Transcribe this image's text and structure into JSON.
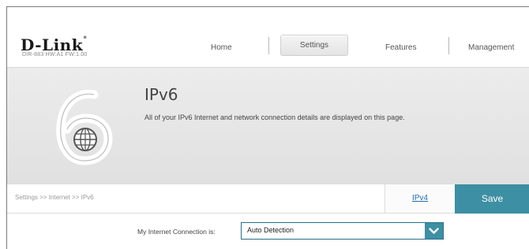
{
  "header": {
    "logo_text": "D-Link",
    "model_info": "DIR-883   HW:A1   FW:1.00",
    "nav": {
      "home": "Home",
      "settings": "Settings",
      "features": "Features",
      "management": "Management"
    }
  },
  "banner": {
    "title": "IPv6",
    "description": "All of your IPv6 Internet and network connection details are displayed on this page.",
    "icon": "ipv6-globe-icon"
  },
  "breadcrumb": {
    "text": "Settings >> Internet >> IPv6",
    "ipv4_link": "IPv4",
    "save_label": "Save"
  },
  "form": {
    "connection_label": "My Internet Connection is:",
    "connection_value": "Auto Detection"
  },
  "colors": {
    "accent": "#3d8fa3",
    "link": "#1f6fae"
  }
}
